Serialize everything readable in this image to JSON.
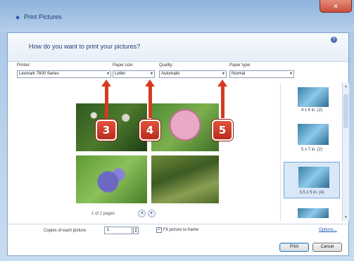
{
  "window": {
    "title": "Print Pictures",
    "close_label": "✕"
  },
  "header": {
    "question": "How do you want to print your pictures?"
  },
  "fields": {
    "printer": {
      "label": "Printer:",
      "value": "Lexmark 7600 Series"
    },
    "paper_size": {
      "label": "Paper size:",
      "value": "Letter"
    },
    "quality": {
      "label": "Quality:",
      "value": "Automatic"
    },
    "paper_type": {
      "label": "Paper type:",
      "value": "Normal"
    },
    "arrow_glyph": "▾"
  },
  "help_glyph": "?",
  "callouts": [
    {
      "number": "3"
    },
    {
      "number": "4"
    },
    {
      "number": "5"
    }
  ],
  "pager": {
    "text": "1 of 2 pages",
    "prev": "◂",
    "next": "▸"
  },
  "layouts": [
    {
      "label": "4 x 6 in. (2)",
      "selected": false
    },
    {
      "label": "5 x 7 in. (2)",
      "selected": false
    },
    {
      "label": "3.5 x 5 in. (4)",
      "selected": true
    }
  ],
  "scroll": {
    "up": "▲",
    "down": "▼"
  },
  "footer": {
    "copies_label": "Copies of each picture:",
    "copies_value": "1",
    "spinner_up": "▴",
    "spinner_down": "▾",
    "fit_label": "Fit picture to frame",
    "fit_checked": "✓",
    "options_link": "Options..."
  },
  "buttons": {
    "print": "Print",
    "cancel": "Cancel"
  },
  "colors": {
    "callout_red": "#d63a22",
    "title_blue": "#1e3c74",
    "link_blue": "#1d5bb3"
  }
}
